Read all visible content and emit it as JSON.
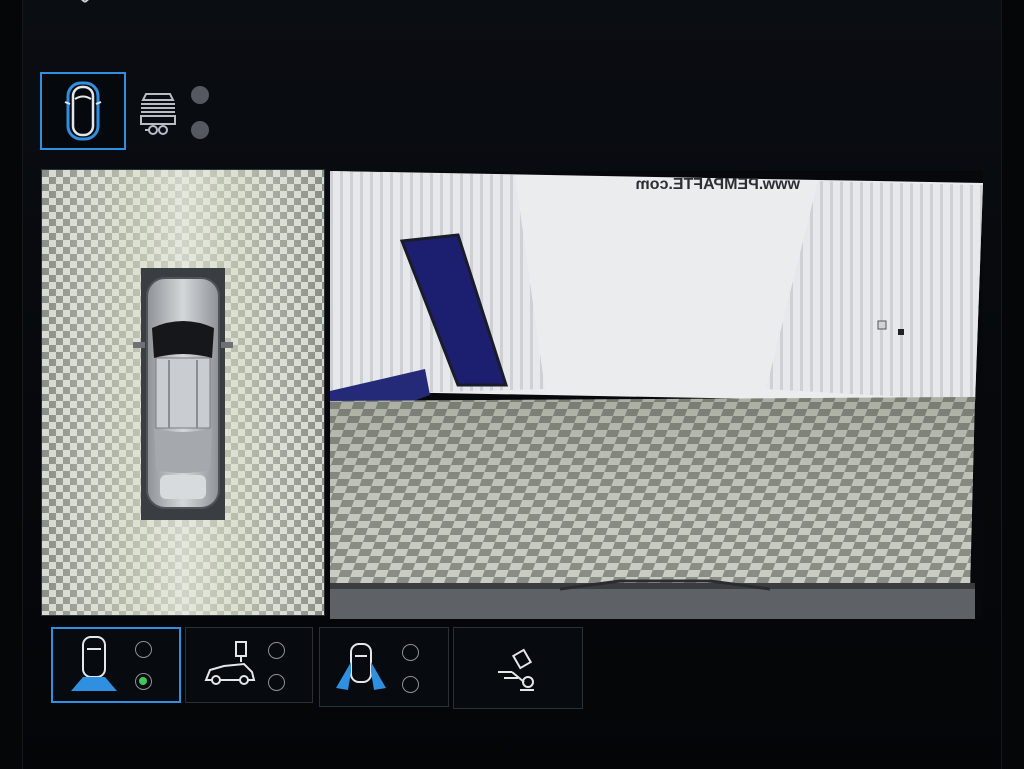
{
  "colors": {
    "accent": "#2f8fe0",
    "active_indicator": "#3cc85a",
    "background": "#06080b",
    "icon_gray": "#c8ccd2"
  },
  "top_views": [
    {
      "name": "overhead-car-view",
      "icon": "car-top-icon",
      "selected": true
    },
    {
      "name": "trailer-view",
      "icon": "trailer-hitch-icon",
      "selected": false
    }
  ],
  "camera_modes": [
    {
      "name": "rear-standard",
      "icon": "car-rear-camera-icon",
      "selected": true,
      "options": [
        "off",
        "on"
      ]
    },
    {
      "name": "trailer-hitch",
      "icon": "car-side-hitch-icon",
      "selected": false,
      "options": [
        "off",
        "off"
      ]
    },
    {
      "name": "side-view",
      "icon": "car-side-camera-icon",
      "selected": false,
      "options": [
        "off",
        "off"
      ]
    },
    {
      "name": "trailer-assist",
      "icon": "trailer-assist-icon",
      "selected": false
    }
  ],
  "rear_camera": {
    "wall_text": "www.PEMPAFTE.com"
  }
}
